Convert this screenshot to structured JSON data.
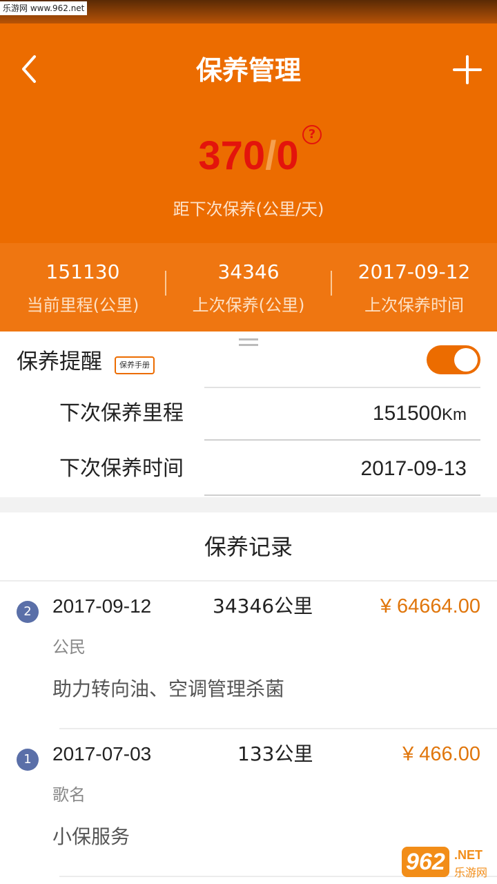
{
  "watermark": {
    "top_text": "乐游网 www.962.net",
    "logo_number": "962",
    "logo_suffix": ".NET",
    "logo_chinese": "乐游网"
  },
  "nav": {
    "title": "保养管理"
  },
  "summary": {
    "km_left": "370",
    "slash": "/",
    "days_left": "0",
    "help_symbol": "?",
    "caption": "距下次保养(公里/天)"
  },
  "stats": [
    {
      "value": "151130",
      "label": "当前里程(公里)"
    },
    {
      "value": "34346",
      "label": "上次保养(公里)"
    },
    {
      "value": "2017-09-12",
      "label": "上次保养时间"
    }
  ],
  "reminder": {
    "title": "保养提醒",
    "manual_badge": "保养手册",
    "enabled": true,
    "next_mileage_label": "下次保养里程",
    "next_mileage_value": "151500",
    "next_mileage_unit": "Km",
    "next_date_label": "下次保养时间",
    "next_date_value": "2017-09-13"
  },
  "records": {
    "title": "保养记录",
    "items": [
      {
        "index": "2",
        "date": "2017-09-12",
        "km": "34346公里",
        "price": "¥ 64664.00",
        "shop": "公民",
        "items": "助力转向油、空调管理杀菌"
      },
      {
        "index": "1",
        "date": "2017-07-03",
        "km": "133公里",
        "price": "¥ 466.00",
        "shop": "歌名",
        "items": "小保服务"
      }
    ]
  },
  "colors": {
    "brand": "#ec6c00",
    "accent_red": "#e3140c",
    "price": "#e0760c",
    "index_badge": "#5a6fa8"
  }
}
